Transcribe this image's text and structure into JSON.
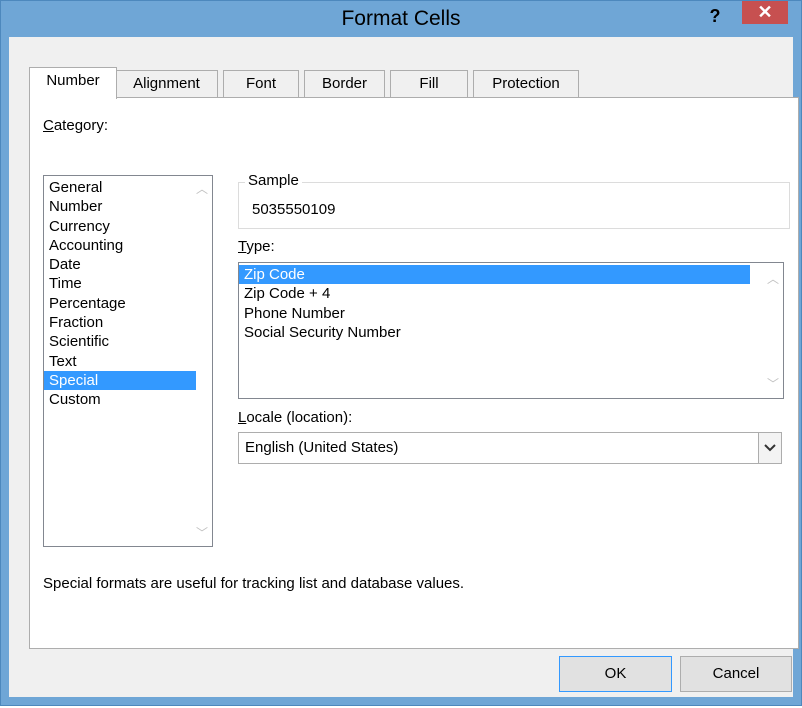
{
  "window": {
    "title": "Format Cells",
    "help_label": "?",
    "close_label": "✕"
  },
  "tabs": [
    {
      "label": "Number"
    },
    {
      "label": "Alignment"
    },
    {
      "label": "Font"
    },
    {
      "label": "Border"
    },
    {
      "label": "Fill"
    },
    {
      "label": "Protection"
    }
  ],
  "category": {
    "label": "Category:",
    "selected": "Special",
    "items": [
      "General",
      "Number",
      "Currency",
      "Accounting",
      "Date",
      "Time",
      "Percentage",
      "Fraction",
      "Scientific",
      "Text",
      "Special",
      "Custom"
    ]
  },
  "sample": {
    "label": "Sample",
    "value": "5035550109"
  },
  "type": {
    "label": "Type:",
    "selected": "Zip Code",
    "items": [
      "Zip Code",
      "Zip Code + 4",
      "Phone Number",
      "Social Security Number"
    ]
  },
  "locale": {
    "label": "Locale (location):",
    "value": "English (United States)"
  },
  "description": "Special formats are useful for tracking list and database values.",
  "buttons": {
    "ok": "OK",
    "cancel": "Cancel"
  },
  "colors": {
    "selection": "#3399ff",
    "title_bar": "#6fa6d6",
    "close_button": "#c75050"
  }
}
